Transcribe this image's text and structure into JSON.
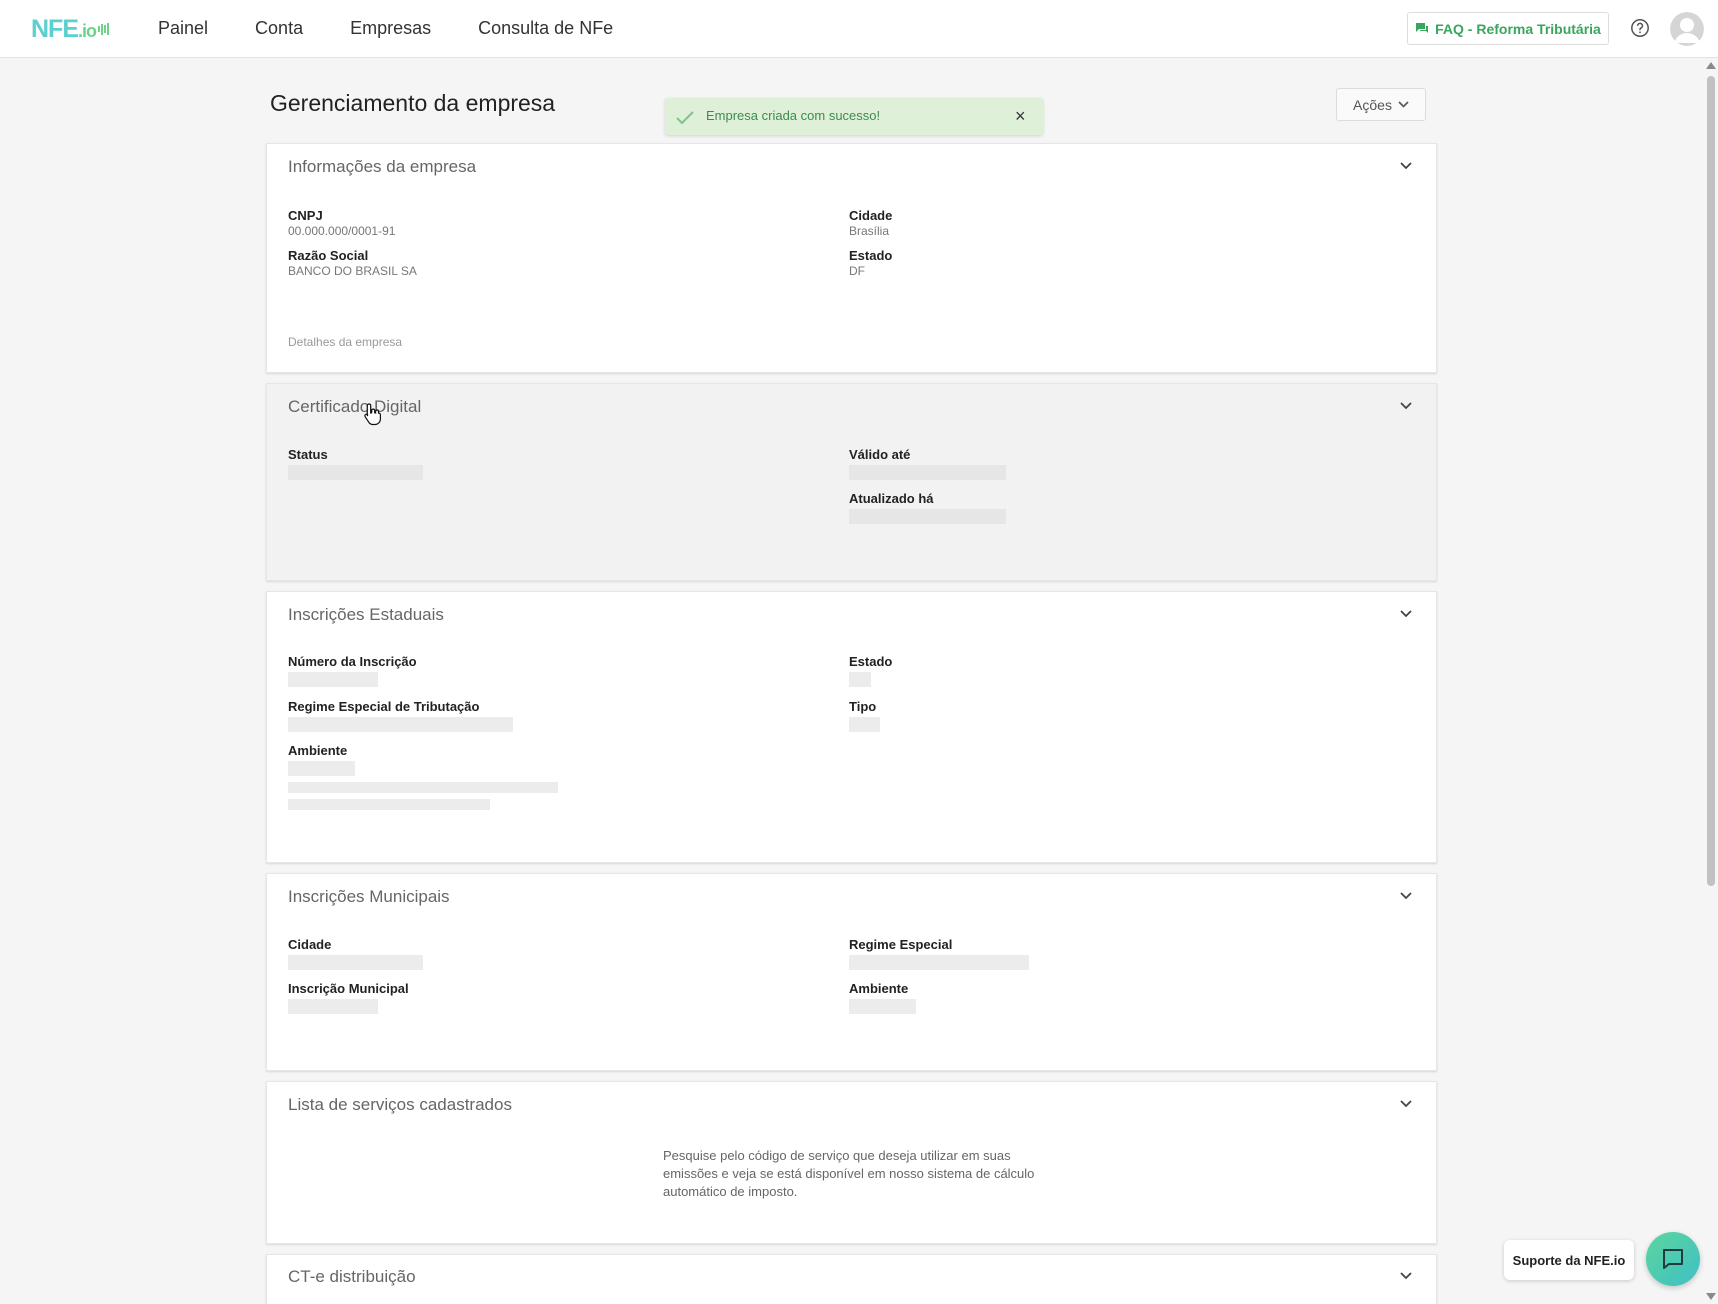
{
  "app": {
    "logo_text": "NFE",
    "logo_suffix": ".io"
  },
  "nav": {
    "items": [
      {
        "label": "Painel"
      },
      {
        "label": "Conta"
      },
      {
        "label": "Empresas"
      },
      {
        "label": "Consulta de NFe"
      }
    ]
  },
  "header": {
    "faq_label": "FAQ - Reforma Tributária",
    "help_icon": "help-circle-icon",
    "avatar_icon": "user-avatar-icon"
  },
  "page": {
    "title": "Gerenciamento da empresa",
    "actions_label": "Ações"
  },
  "toast": {
    "message": "Empresa criada com sucesso!",
    "close": "×",
    "color": "#dff0d8"
  },
  "company_info": {
    "title": "Informações da empresa",
    "cnpj_label": "CNPJ",
    "cnpj_value": "00.000.000/0001-91",
    "razao_label": "Razão Social",
    "razao_value": "BANCO DO BRASIL SA",
    "cidade_label": "Cidade",
    "cidade_value": "Brasília",
    "estado_label": "Estado",
    "estado_value": "DF",
    "details_link": "Detalhes da empresa"
  },
  "certificate": {
    "title": "Certificado Digital",
    "status_label": "Status",
    "valid_until_label": "Válido até",
    "updated_label": "Atualizado há"
  },
  "state_registrations": {
    "title": "Inscrições Estaduais",
    "number_label": "Número da Inscrição",
    "state_label": "Estado",
    "regime_label": "Regime Especial de Tributação",
    "type_label": "Tipo",
    "environment_label": "Ambiente"
  },
  "municipal_registrations": {
    "title": "Inscrições Municipais",
    "city_label": "Cidade",
    "regime_label": "Regime Especial",
    "registration_label": "Inscrição Municipal",
    "environment_label": "Ambiente"
  },
  "services": {
    "title": "Lista de serviços cadastrados",
    "description": "Pesquise pelo código de serviço que deseja utilizar em suas emissões e veja se está disponível em nosso sistema de cálculo automático de imposto."
  },
  "cte": {
    "title": "CT-e distribuição"
  },
  "support": {
    "label": "Suporte da NFE.io",
    "accent": "#4fcaa9"
  }
}
